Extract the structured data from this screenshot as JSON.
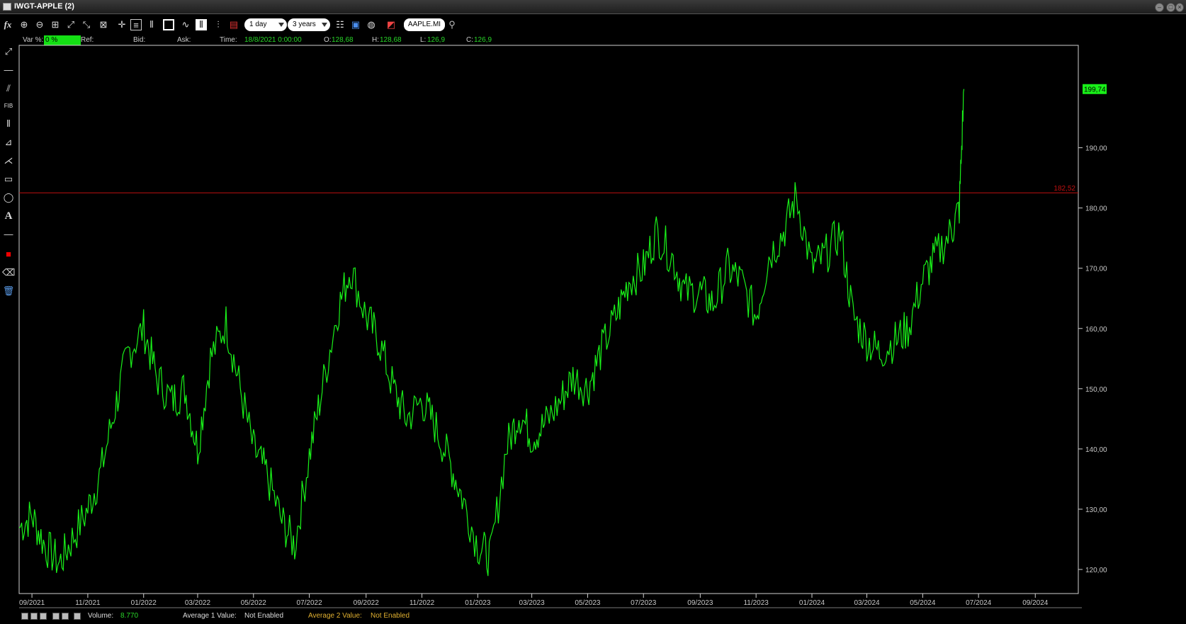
{
  "window": {
    "title": "IWGT-APPLE (2)"
  },
  "toolbar": {
    "fx_label": "fx",
    "interval": "1 day",
    "range": "3 years",
    "symbol": "AAPLE.MI",
    "icons": [
      "fx-icon",
      "zoom-in-icon",
      "zoom-out-icon",
      "zoom-box-icon",
      "zoom-x-icon",
      "zoom-y-icon",
      "crosshair-icon",
      "list-icon",
      "grid-icon",
      "frame-icon",
      "line-chart-icon",
      "candle-icon",
      "bar-icon",
      "legend-icon",
      "table-icon",
      "save-icon",
      "globe-icon",
      "palette-icon",
      "search-icon"
    ]
  },
  "info": {
    "var_label": "Var %:",
    "var_value": "0 %",
    "ref_label": "Ref:",
    "bid_label": "Bid:",
    "ask_label": "Ask:",
    "time_label": "Time:",
    "time_value": "18/8/2021 0:00:00",
    "open_label": "O:",
    "open_value": "128,68",
    "high_label": "H:",
    "high_value": "128,68",
    "low_label": "L:",
    "low_value": "126,9",
    "close_label": "C:",
    "close_value": "126,9"
  },
  "left_tools": [
    "trendline-icon",
    "horizontal-line-icon",
    "parallel-lines-icon",
    "fibonacci-icon",
    "vertical-lines-icon",
    "gann-icon",
    "pitchfork-icon",
    "rectangle-icon",
    "ellipse-icon",
    "text-icon",
    "separator-icon",
    "color-icon",
    "eraser-icon",
    "trash-icon"
  ],
  "left_tools_text": {
    "fib": "FIB",
    "text": "A"
  },
  "bottom": {
    "volume_label": "Volume:",
    "volume_value": "8.770",
    "avg1_label": "Average 1 Value:",
    "avg1_value": "Not Enabled",
    "avg2_label": "Average 2 Value:",
    "avg2_value": "Not Enabled"
  },
  "colors": {
    "series": "#19f019",
    "hline": "#c01010",
    "last_price_bg": "#19f019",
    "axis_text": "#c8c8c8",
    "frame": "#d0d0d0"
  },
  "chart_data": {
    "type": "line",
    "title": "",
    "xlabel": "",
    "ylabel": "",
    "ylim": [
      116,
      207
    ],
    "y_ticks": [
      120,
      130,
      140,
      150,
      160,
      170,
      180,
      190
    ],
    "y_tick_labels": [
      "120,00",
      "130,00",
      "140,00",
      "150,00",
      "160,00",
      "170,00",
      "180,00",
      "190,00"
    ],
    "x_range": [
      "2021-08-18",
      "2024-10-18"
    ],
    "x_ticks": [
      "2021-09-01",
      "2021-11-01",
      "2022-01-01",
      "2022-03-01",
      "2022-05-01",
      "2022-07-01",
      "2022-09-01",
      "2022-11-01",
      "2023-01-01",
      "2023-03-01",
      "2023-05-01",
      "2023-07-01",
      "2023-09-01",
      "2023-11-01",
      "2024-01-01",
      "2024-03-01",
      "2024-05-01",
      "2024-07-01",
      "2024-09-01"
    ],
    "x_tick_labels": [
      "09/2021",
      "11/2021",
      "01/2022",
      "03/2022",
      "05/2022",
      "07/2022",
      "09/2022",
      "11/2022",
      "01/2023",
      "03/2023",
      "05/2023",
      "07/2023",
      "09/2023",
      "11/2023",
      "01/2024",
      "03/2024",
      "05/2024",
      "07/2024",
      "09/2024"
    ],
    "horizontal_line": {
      "value": 182.52,
      "label": "182,52"
    },
    "last_price": {
      "value": 199.74,
      "label": "199,74"
    },
    "grid": false,
    "series": [
      {
        "x": [
          "2021-08-18",
          "2021-09-01",
          "2021-09-15",
          "2021-10-01",
          "2021-10-15",
          "2021-11-01",
          "2021-11-15",
          "2021-12-01",
          "2021-12-15",
          "2022-01-01",
          "2022-01-15",
          "2022-02-01",
          "2022-02-15",
          "2022-03-01",
          "2022-03-15",
          "2022-04-01",
          "2022-04-15",
          "2022-05-01",
          "2022-05-15",
          "2022-06-01",
          "2022-06-15",
          "2022-07-01",
          "2022-07-15",
          "2022-08-01",
          "2022-08-15",
          "2022-09-01",
          "2022-09-15",
          "2022-10-01",
          "2022-10-15",
          "2022-11-01",
          "2022-11-15",
          "2022-12-01",
          "2022-12-15",
          "2023-01-01",
          "2023-01-15",
          "2023-02-01",
          "2023-02-15",
          "2023-03-01",
          "2023-03-15",
          "2023-04-01",
          "2023-04-15",
          "2023-05-01",
          "2023-05-15",
          "2023-06-01",
          "2023-06-15",
          "2023-07-01",
          "2023-07-15",
          "2023-08-01",
          "2023-08-15",
          "2023-09-01",
          "2023-09-15",
          "2023-10-01",
          "2023-10-15",
          "2023-11-01",
          "2023-11-15",
          "2023-12-01",
          "2023-12-15",
          "2024-01-01",
          "2024-01-15",
          "2024-02-01",
          "2024-02-15",
          "2024-03-01",
          "2024-03-15",
          "2024-04-01",
          "2024-04-15",
          "2024-05-01",
          "2024-05-15",
          "2024-06-01",
          "2024-06-10",
          "2024-06-15"
        ],
        "values": [
          126.9,
          129,
          124,
          121,
          125,
          130,
          136,
          147,
          156,
          160,
          152,
          148,
          150,
          140,
          155,
          161,
          151,
          140,
          136,
          128,
          124,
          139,
          150,
          163,
          170,
          162,
          158,
          150,
          145,
          148,
          144,
          138,
          132,
          124,
          122,
          140,
          146,
          142,
          144,
          148,
          152,
          150,
          156,
          162,
          168,
          170,
          176,
          172,
          166,
          166,
          164,
          170,
          168,
          162,
          172,
          176,
          182,
          170,
          172,
          176,
          162,
          158,
          156,
          158,
          160,
          168,
          172,
          176,
          180,
          199.74
        ]
      }
    ]
  }
}
